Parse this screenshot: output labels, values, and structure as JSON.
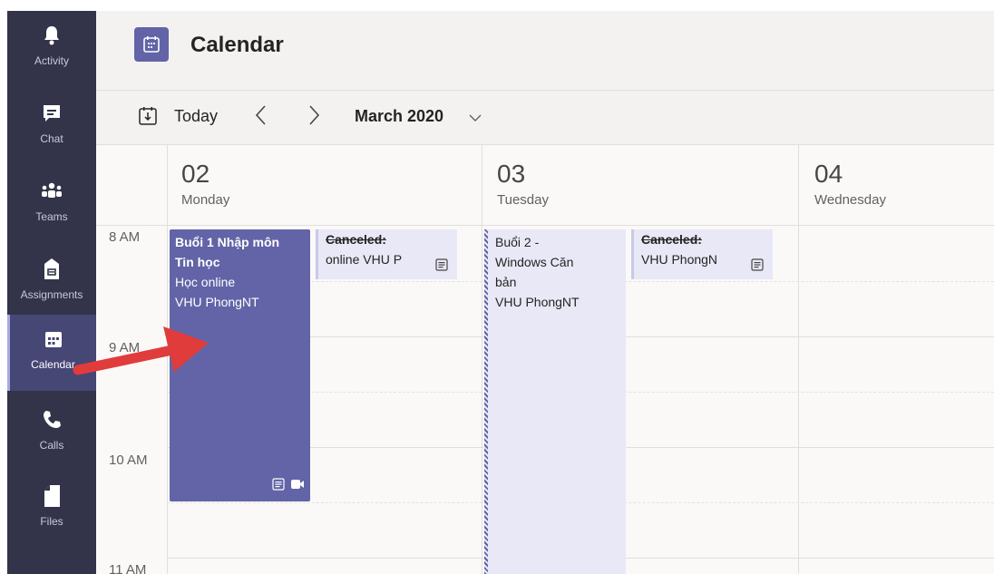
{
  "rail": [
    {
      "icon": "bell-icon",
      "label": "Activity"
    },
    {
      "icon": "chat-icon",
      "label": "Chat"
    },
    {
      "icon": "teams-icon",
      "label": "Teams"
    },
    {
      "icon": "assignments-icon",
      "label": "Assignments"
    },
    {
      "icon": "calendar-icon",
      "label": "Calendar",
      "active": true
    },
    {
      "icon": "phone-icon",
      "label": "Calls"
    },
    {
      "icon": "file-icon",
      "label": "Files"
    }
  ],
  "header": {
    "title": "Calendar"
  },
  "toolbar": {
    "today": "Today",
    "month": "March 2020"
  },
  "days": [
    {
      "num": "02",
      "name": "Monday"
    },
    {
      "num": "03",
      "name": "Tuesday"
    },
    {
      "num": "04",
      "name": "Wednesday"
    }
  ],
  "times": [
    "8 AM",
    "9 AM",
    "10 AM",
    "11 AM"
  ],
  "events": {
    "mon_main": {
      "line1": "Buổi 1 Nhập môn",
      "line2": "Tin học",
      "line3": "Học online",
      "line4": "VHU PhongNT"
    },
    "mon_cancel": {
      "status": "Canceled:",
      "text": "online  VHU P"
    },
    "tue_main": {
      "line1": "Buổi 2 -",
      "line2": "Windows Căn",
      "line3": "bản",
      "line4": "VHU PhongNT"
    },
    "tue_cancel": {
      "status": "Canceled:",
      "text": "VHU PhongN"
    }
  },
  "colors": {
    "rail": "#33344a",
    "accent": "#6264a7",
    "annotation_arrow": "#e03c3c"
  }
}
